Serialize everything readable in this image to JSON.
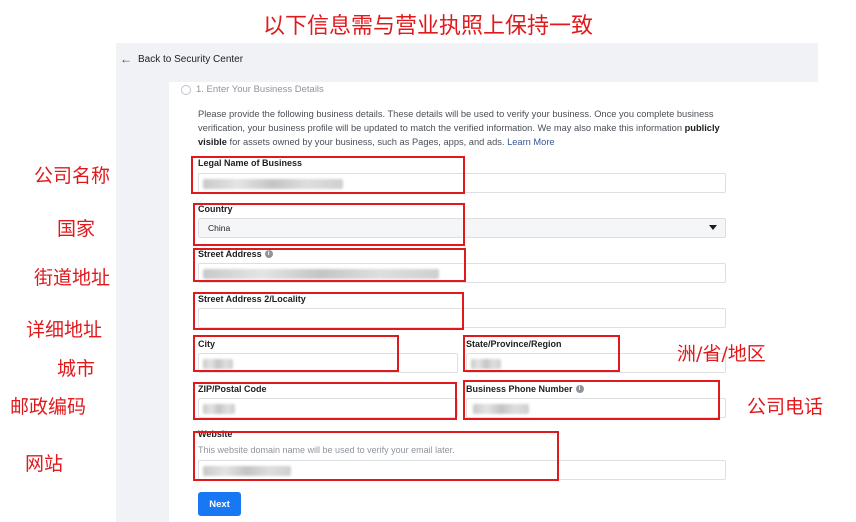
{
  "annotation": {
    "title": "以下信息需与营业执照上保持一致",
    "legal_name": "公司名称",
    "country": "国家",
    "street": "街道地址",
    "street2": "详细地址",
    "city": "城市",
    "postal": "邮政编码",
    "website": "网站",
    "state": "洲/省/地区",
    "phone": "公司电话"
  },
  "nav": {
    "back_label": "Back to Security Center"
  },
  "step": {
    "label": "1. Enter Your Business Details"
  },
  "description": {
    "part1": "Please provide the following business details. These details will be used to verify your business. Once you complete business verification, your business profile will be updated to match the verified information. We may also make this information ",
    "bold": "publicly visible",
    "part2": " for assets owned by your business, such as Pages, apps, and ads. ",
    "link": "Learn More"
  },
  "form": {
    "legal_name_label": "Legal Name of Business",
    "country_label": "Country",
    "country_value": "China",
    "street_label": "Street Address",
    "street2_label": "Street Address 2/Locality",
    "city_label": "City",
    "state_label": "State/Province/Region",
    "postal_label": "ZIP/Postal Code",
    "phone_label": "Business Phone Number",
    "website_label": "Website",
    "website_hint": "This website domain name will be used to verify your email later.",
    "next_label": "Next"
  },
  "icons": {
    "back": "arrow-left-icon",
    "info": "info-icon",
    "step": "radio-circle-icon",
    "dropdown": "caret-down-icon"
  },
  "colors": {
    "annotation_red": "#e0191c",
    "primary_blue": "#1877f2",
    "link": "#385898"
  }
}
